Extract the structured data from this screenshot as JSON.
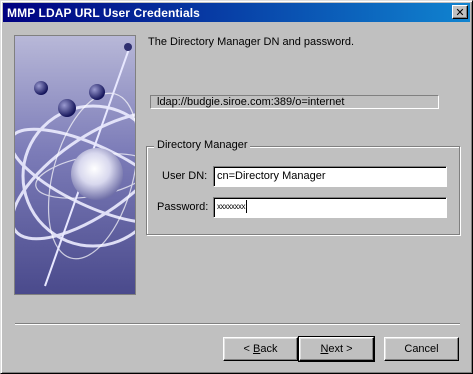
{
  "window": {
    "title": "MMP LDAP URL User Credentials",
    "close_glyph": "✕"
  },
  "page": {
    "heading": "The Directory Manager DN and password.",
    "ldap_url": "ldap://budgie.siroe.com:389/o=internet"
  },
  "group": {
    "legend": "Directory Manager",
    "user_dn_label": "User DN:",
    "user_dn_value": "cn=Directory Manager",
    "password_label": "Password:",
    "password_value": "xxxxxxxx"
  },
  "buttons": {
    "back": {
      "prefix": "< ",
      "mnemonic": "B",
      "rest": "ack"
    },
    "next": {
      "mnemonic": "N",
      "rest": "ext >"
    },
    "cancel": {
      "label": "Cancel"
    }
  },
  "icons": {
    "wizard_art": "globe-orbits-illustration",
    "close": "close-icon"
  },
  "colors": {
    "titlebar_start": "#000080",
    "titlebar_end": "#1084d0",
    "dialog_face": "#c0c0c0"
  }
}
